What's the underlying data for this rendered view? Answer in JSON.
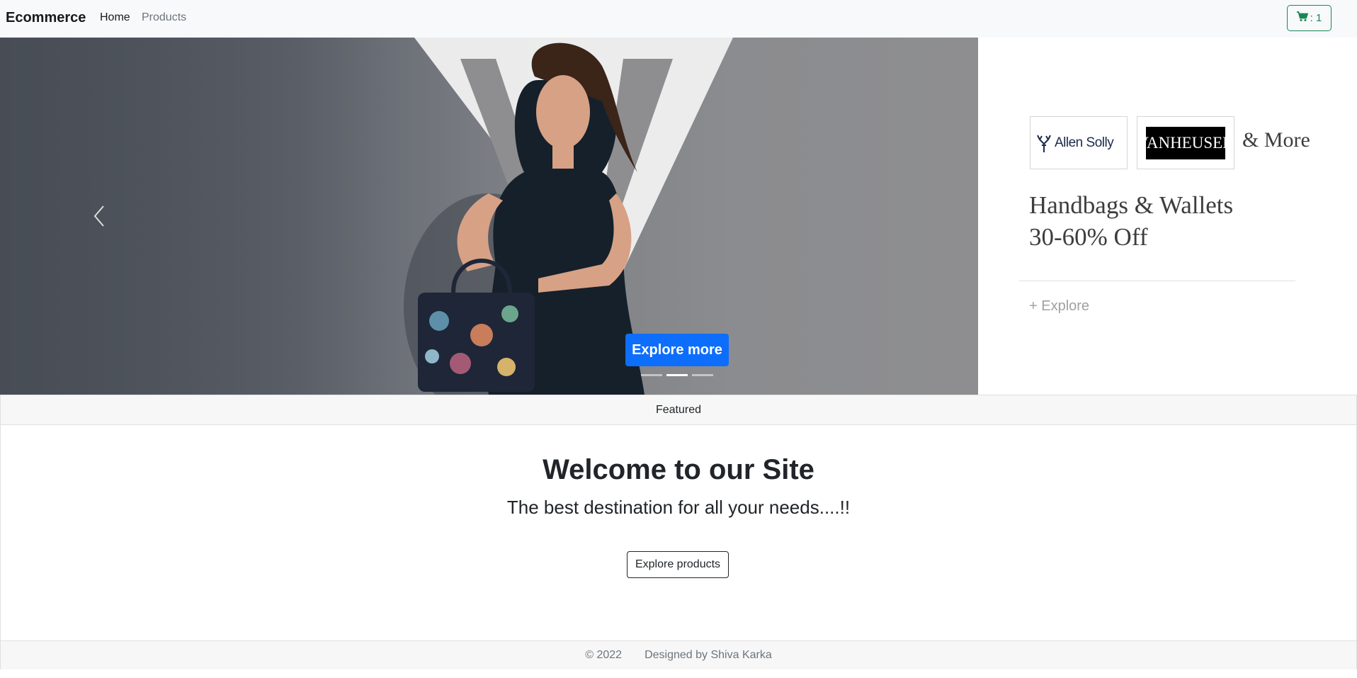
{
  "navbar": {
    "brand": "Ecommerce",
    "links": [
      {
        "label": "Home"
      },
      {
        "label": "Products"
      }
    ],
    "cart": {
      "icon": "cart-icon",
      "label": ": 1",
      "color": "#198754"
    }
  },
  "carousel": {
    "explore_button": "Explore more",
    "explore_button_color": "#0d6efd",
    "active_slide_index": 1,
    "slide_count": 3
  },
  "promo": {
    "brands": [
      "Allen Solly",
      "VANHEUSEN"
    ],
    "and_more": "& More",
    "headline_line1": "Handbags & Wallets",
    "headline_line2": "30-60% Off",
    "explore_link": "+ Explore"
  },
  "card": {
    "header": "Featured",
    "title": "Welcome to our Site",
    "text": "The best destination for all your needs....!!",
    "button": "Explore products",
    "footer_copyright": "© 2022",
    "footer_credit": "Designed by Shiva Karka"
  }
}
